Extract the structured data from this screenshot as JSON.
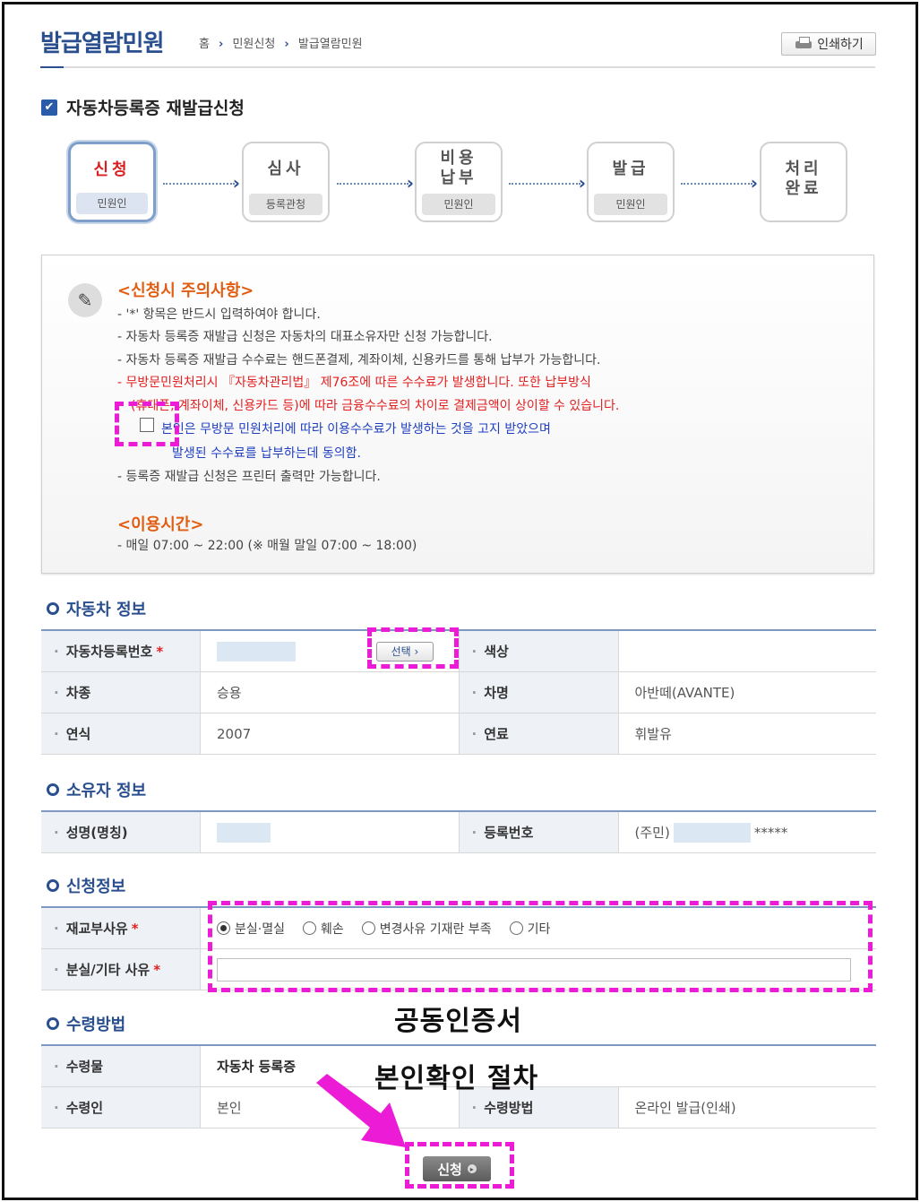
{
  "header": {
    "title": "발급열람민원",
    "breadcrumb": [
      "홈",
      "민원신청",
      "발급열람민원"
    ],
    "print_label": "인쇄하기"
  },
  "section_title": "자동차등록증 재발급신청",
  "steps": [
    {
      "name": "신청",
      "sub": "민원인"
    },
    {
      "name": "심사",
      "sub": "등록관청"
    },
    {
      "name_line1": "비용",
      "name_line2": "납부",
      "sub": "민원인"
    },
    {
      "name": "발급",
      "sub": "민원인"
    },
    {
      "name_line1": "처리",
      "name_line2": "완료"
    }
  ],
  "notice": {
    "title": "<신청시 주의사항>",
    "lines": [
      "- '*' 항목은 반드시 입력하여야 합니다.",
      "- 자동차 등록증 재발급 신청은 자동차의 대표소유자만 신청 가능합니다.",
      "- 자동차 등록증 재발급 수수료는 핸드폰결제, 계좌이체, 신용카드를 통해 납부가 가능합니다.",
      "- 무방문민원처리시 『자동차관리법』 제76조에 따른 수수료가 발생합니다. 또한 납부방식",
      "(휴대폰, 계좌이체, 신용카드 등)에 따라 금융수수료의 차이로 결제금액이 상이할 수 있습니다.",
      "본인은 무방문 민원처리에 따라 이용수수료가 발생하는 것을 고지 받았으며",
      "발생된 수수료를 납부하는데 동의함.",
      "- 등록증 재발급 신청은 프린터 출력만 가능합니다."
    ],
    "time_title": "<이용시간>",
    "time_line": "- 매일 07:00 ~ 22:00 (※ 매월 말일 07:00 ~ 18:00)"
  },
  "vehicle": {
    "title": "자동차 정보",
    "reg_no_label": "자동차등록번호",
    "select_label": "선택",
    "color_label": "색상",
    "type_label": "차종",
    "type_value": "승용",
    "model_label": "차명",
    "model_value": "아반떼(AVANTE)",
    "year_label": "연식",
    "year_value": "2007",
    "fuel_label": "연료",
    "fuel_value": "휘발유"
  },
  "owner": {
    "title": "소유자 정보",
    "name_label": "성명(명칭)",
    "regnum_label": "등록번호",
    "regnum_prefix": "(주민)",
    "regnum_suffix": "*****"
  },
  "application": {
    "title": "신청정보",
    "reason_label": "재교부사유",
    "options": [
      "분실·멸실",
      "훼손",
      "변경사유 기재란 부족",
      "기타"
    ],
    "detail_label": "분실/기타 사유"
  },
  "receive": {
    "title": "수령방법",
    "item_label": "수령물",
    "item_value": "자동차 등록증",
    "person_label": "수령인",
    "person_value": "본인",
    "method_label": "수령방법",
    "method_value": "온라인 발급(인쇄)"
  },
  "callout": {
    "line1": "공동인증서",
    "line2": "본인확인 절차"
  },
  "submit_label": "신청",
  "colors": {
    "highlight": "#ec1bd6",
    "brand": "#2a4f8f",
    "warning": "#e32020"
  }
}
